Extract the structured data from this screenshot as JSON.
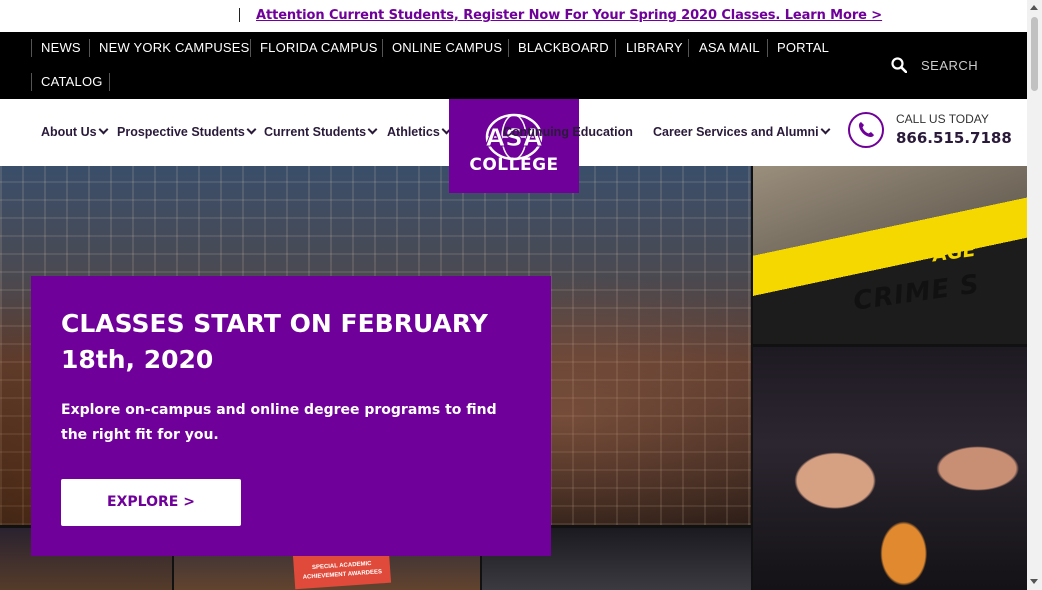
{
  "announcement": {
    "text": "Attention Current Students, Register Now For Your Spring 2020 Classes. Learn More >"
  },
  "topnav": {
    "links": [
      "NEWS",
      "NEW YORK CAMPUSES",
      "FLORIDA CAMPUS",
      "ONLINE CAMPUS",
      "BLACKBOARD",
      "LIBRARY",
      "ASA MAIL",
      "PORTAL",
      "CATALOG"
    ],
    "search_label": "SEARCH"
  },
  "mainnav": {
    "items": [
      "About Us",
      "Prospective Students",
      "Current Students",
      "Athletics",
      "Continuing Education",
      "Career Services and Alumni"
    ]
  },
  "logo": {
    "mark": "ASA",
    "word": "COLLEGE"
  },
  "contact": {
    "label": "CALL US TODAY",
    "number": "866.515.7188"
  },
  "hero": {
    "title": "CLASSES START ON FEBRUARY 18th, 2020",
    "description": "Explore on-campus and online degree programs to find the right fit for you.",
    "button": "EXPLORE >",
    "photo_text": {
      "tape": "CRIME S",
      "tape_upper": "FUT FE AGE",
      "sign": "SPECIAL ACADEMIC ACHIEVEMENT AWARDEES"
    }
  },
  "colors": {
    "brand_purple": "#6f0099",
    "topnav_bg": "#000000"
  }
}
